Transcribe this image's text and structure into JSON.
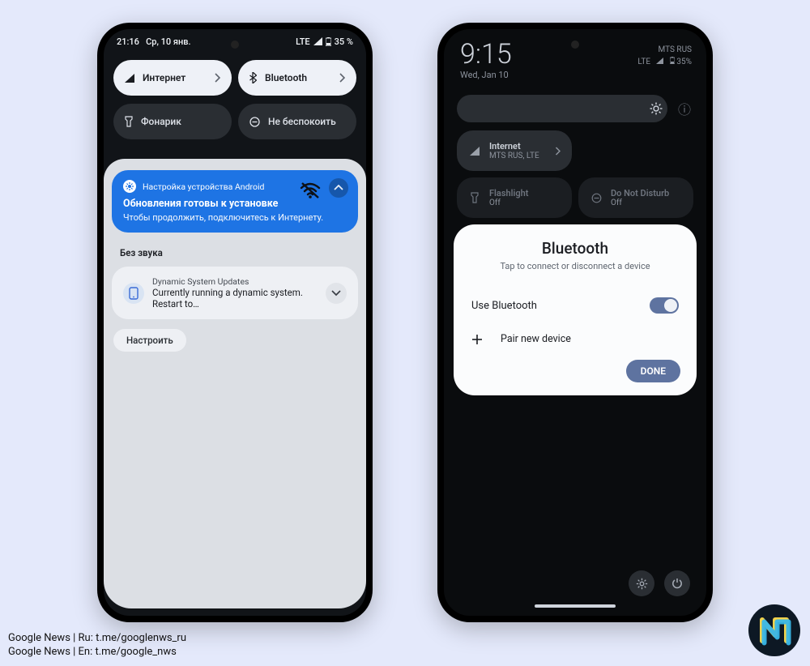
{
  "phone1": {
    "status": {
      "time": "21:16",
      "date": "Ср, 10 янв.",
      "net": "LTE",
      "battery": "35 %"
    },
    "qs": {
      "internet": "Интернет",
      "bluetooth": "Bluetooth",
      "flashlight": "Фонарик",
      "dnd": "Не беспокоить"
    },
    "notif_update": {
      "app": "Настройка устройства Android",
      "title": "Обновления готовы к установке",
      "body": "Чтобы продолжить, подключитесь к Интернету."
    },
    "silent_label": "Без звука",
    "notif_dsu": {
      "app": "Dynamic System Updates",
      "body": "Currently running a dynamic system. Restart to…"
    },
    "manage": "Настроить"
  },
  "phone2": {
    "clock": "9:15",
    "date": "Wed, Jan 10",
    "carrier": "MTS RUS",
    "net": "LTE",
    "battery": "35%",
    "qs": {
      "internet_label": "Internet",
      "internet_sub": "MTS RUS, LTE",
      "flashlight_label": "Flashlight",
      "flashlight_sub": "Off",
      "dnd_label": "Do Not Disturb",
      "dnd_sub": "Off"
    },
    "bt": {
      "title": "Bluetooth",
      "subtitle": "Tap to connect or disconnect a device",
      "use_label": "Use Bluetooth",
      "pair_label": "Pair new device",
      "done": "DONE"
    }
  },
  "credits": {
    "line1": "Google News | Ru: t.me/googlenws_ru",
    "line2": "Google News | En: t.me/google_nws"
  }
}
